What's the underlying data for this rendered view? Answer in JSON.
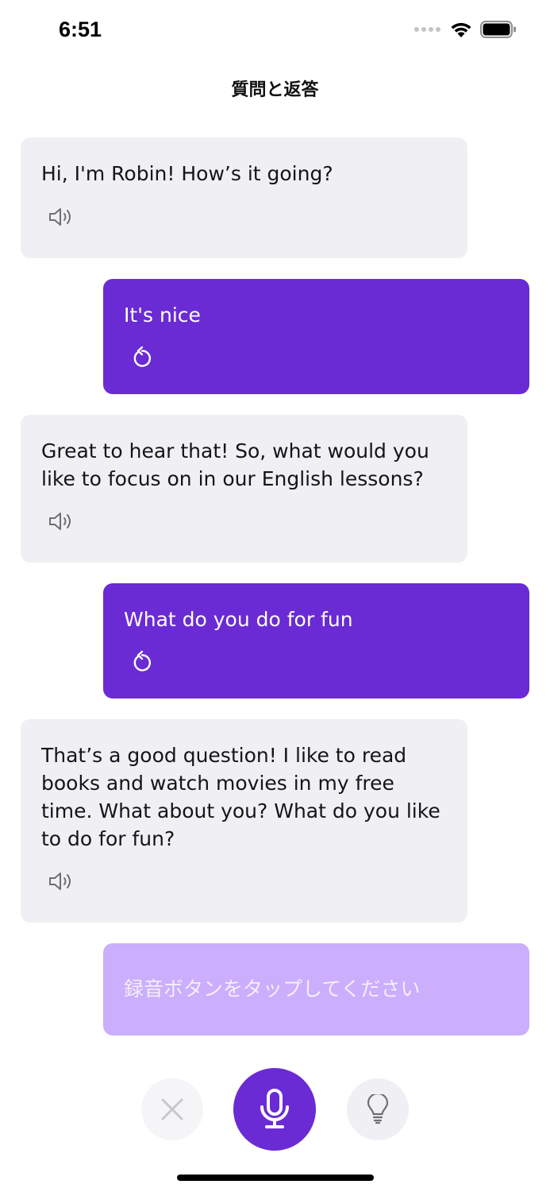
{
  "status_bar": {
    "time": "6:51",
    "icons": [
      "cellular-signal-icon",
      "wifi-icon",
      "battery-icon"
    ]
  },
  "nav": {
    "title": "質問と返答"
  },
  "messages": [
    {
      "role": "bot",
      "text": "Hi, I'm Robin! How’s it going?",
      "icon": "speaker-icon"
    },
    {
      "role": "user",
      "text": "It's nice",
      "icon": "replay-icon"
    },
    {
      "role": "bot",
      "text": "Great to hear that! So, what would you like to focus on in our English lessons?",
      "icon": "speaker-icon"
    },
    {
      "role": "user",
      "text": "What do you do for fun",
      "icon": "replay-icon"
    },
    {
      "role": "bot",
      "text": "That’s a good question! I like to read books and watch movies in my free time. What about you? What do you like to do for fun?",
      "icon": "speaker-icon"
    }
  ],
  "pending": {
    "placeholder": "録音ボタンをタップしてください"
  },
  "controls": {
    "cancel_icon": "close-icon",
    "record_icon": "microphone-icon",
    "hint_icon": "lightbulb-icon"
  },
  "colors": {
    "accent": "#6A2BD4",
    "pending_bubble": "#CBAEFC",
    "bot_bubble": "#F0F0F4",
    "control_gray": "#F0F0F4"
  }
}
